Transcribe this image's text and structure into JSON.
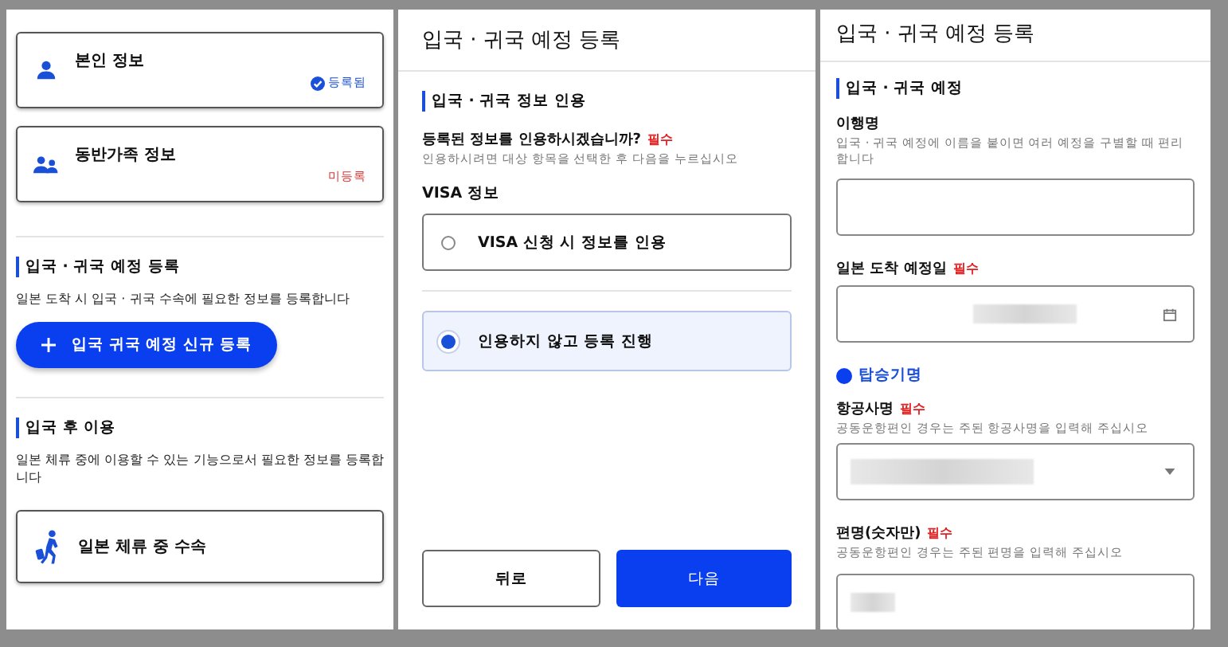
{
  "home": {
    "cards": [
      {
        "kind": "person",
        "title": "본인 정보",
        "status": "등록됨",
        "registered": true
      },
      {
        "kind": "family",
        "title": "동반가족 정보",
        "status": "미등록",
        "registered": false
      }
    ],
    "sections": [
      {
        "heading": "입국 · 귀국 예정 등록",
        "description": "일본 도착 시 입국 · 귀국 수속에 필요한 정보를 등록합니다",
        "action": {
          "kind": "button",
          "label": "입국 귀국 예정 신규 등록"
        }
      },
      {
        "heading": "입국 후 이용",
        "description": "일본 체류 중에 이용할 수 있는 기능으로서 필요한 정보를 등록합니다",
        "action": {
          "kind": "card",
          "label": "일본 체류 중 수속"
        }
      }
    ]
  },
  "quote_step": {
    "title": "입국 · 귀국 예정 등록",
    "section": "입국 · 귀국 정보 인용",
    "question": "등록된 정보를 인용하시겠습니까?",
    "required_label": "필수",
    "hint": "인용하시려면 대상 항목을 선택한 후 다음을 누르십시오",
    "group": "VISA 정보",
    "options": [
      {
        "label": "VISA 신청 시 정보를 인용",
        "selected": false
      },
      {
        "label": "인용하지 않고 등록 진행",
        "selected": true
      }
    ],
    "buttons": [
      {
        "label": "뒤로",
        "primary": false
      },
      {
        "label": "다음",
        "primary": true
      }
    ]
  },
  "form_step": {
    "title": "입국 · 귀국 예정 등록",
    "section": "입국 · 귀국 예정",
    "fields": [
      {
        "kind": "text",
        "label": "이행명",
        "help": "입국 · 귀국 예정에 이름을 붙이면 여러 예정을 구별할 때 편리합니다",
        "value_hidden": false
      },
      {
        "kind": "date",
        "label": "일본 도착 예정일",
        "required_label": "필수",
        "value_hidden": true
      },
      {
        "kind": "heading",
        "label": "탑승기명"
      },
      {
        "kind": "select",
        "label": "항공사명",
        "required_label": "필수",
        "help": "공동운항편인 경우는 주된 항공사명을 입력해 주십시오",
        "value_hidden": true
      },
      {
        "kind": "text",
        "label": "편명(숫자만)",
        "required_label": "필수",
        "help": "공동운항편인 경우는 주된 편명을 입력해 주십시오",
        "value_hidden": true
      }
    ]
  }
}
